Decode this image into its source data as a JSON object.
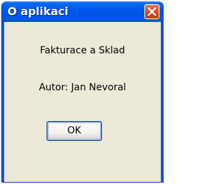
{
  "window": {
    "title": "O aplikaci",
    "close_icon": "close-x-icon"
  },
  "content": {
    "app_name": "Fakturace a Sklad",
    "author": "Autor: Jan Nevoral"
  },
  "buttons": {
    "ok_label": "OK"
  }
}
